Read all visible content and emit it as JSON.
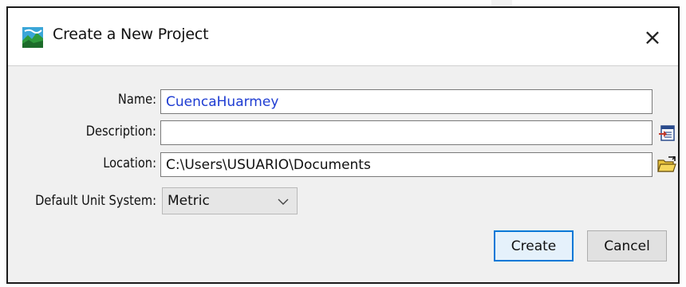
{
  "window": {
    "title": "Create a New Project",
    "close_glyph": "×"
  },
  "form": {
    "name": {
      "label": "Name:",
      "value": "CuencaHuarmey"
    },
    "description": {
      "label": "Description:",
      "value": ""
    },
    "location": {
      "label": "Location:",
      "value": "C:\\Users\\USUARIO\\Documents"
    },
    "unit_system": {
      "label": "Default Unit System:",
      "selected": "Metric"
    }
  },
  "buttons": {
    "create": "Create",
    "cancel": "Cancel"
  },
  "icons": {
    "app": "hec-hms-app-icon",
    "description_button": "edit-description-icon",
    "location_button": "open-folder-icon",
    "dropdown": "chevron-down-icon",
    "close": "close-icon"
  },
  "colors": {
    "name_text": "#1e3cd2",
    "create_border": "#0078d7",
    "dialog_bg": "#f0f0f0"
  }
}
